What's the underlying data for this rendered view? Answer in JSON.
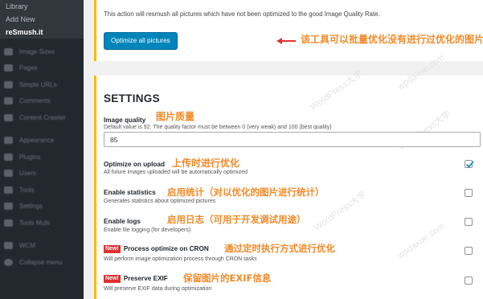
{
  "sidebar": {
    "submenu": [
      "Library",
      "Add New",
      "reSmush.it"
    ],
    "menu": [
      "Image Sizes",
      "Pages",
      "Simple URLs",
      "Comments",
      "Content Crawler",
      "Appearance",
      "Plugins",
      "Users",
      "Tools",
      "Settings",
      "Tools Multi",
      "WCM",
      "Collapse menu"
    ]
  },
  "optimize_all": {
    "description": "This action will resmush all pictures which have not been optimized to the good Image Quality Rate.",
    "button_label": "Optimize all pictures",
    "annotation": "该工具可以批量优化没有进行过优化的图片"
  },
  "settings": {
    "heading": "SETTINGS",
    "image_quality": {
      "label": "Image quality",
      "help": "Default value is 92. The quality factor must be between 0 (very weak) and 100 (best quality)",
      "value": "85",
      "annotation": "图片质量"
    },
    "optimize_on_upload": {
      "label": "Optimize on upload",
      "help": "All future images uploaded will be automatically optimized",
      "checked": true,
      "annotation": "上传时进行优化"
    },
    "enable_statistics": {
      "label": "Enable statistics",
      "help": "Generates statistics about optimized pictures",
      "checked": false,
      "annotation": "启用统计（对以优化的图片进行统计）"
    },
    "enable_logs": {
      "label": "Enable logs",
      "help": "Enable file logging (for developers)",
      "checked": false,
      "annotation": "启用日志（可用于开发调试用途）"
    },
    "process_cron": {
      "badge": "New!",
      "label": "Process optimize on CRON",
      "help": "Will perform image optimization process through CRON tasks",
      "checked": false,
      "annotation": "通过定时执行方式进行优化"
    },
    "preserve_exif": {
      "badge": "New!",
      "label": "Preserve EXIF",
      "help": "Will preserve EXIF data during optimization",
      "checked": false,
      "annotation": "保留图片的EXIF信息"
    }
  },
  "watermarks": [
    "WordPress大学",
    "wpdaxue.com"
  ],
  "colors": {
    "annotation": "#f28a29",
    "accent_border": "#ffb900",
    "button": "#0085ba",
    "checkmark": "#1e8cbe",
    "arrow": "#dc3232"
  }
}
